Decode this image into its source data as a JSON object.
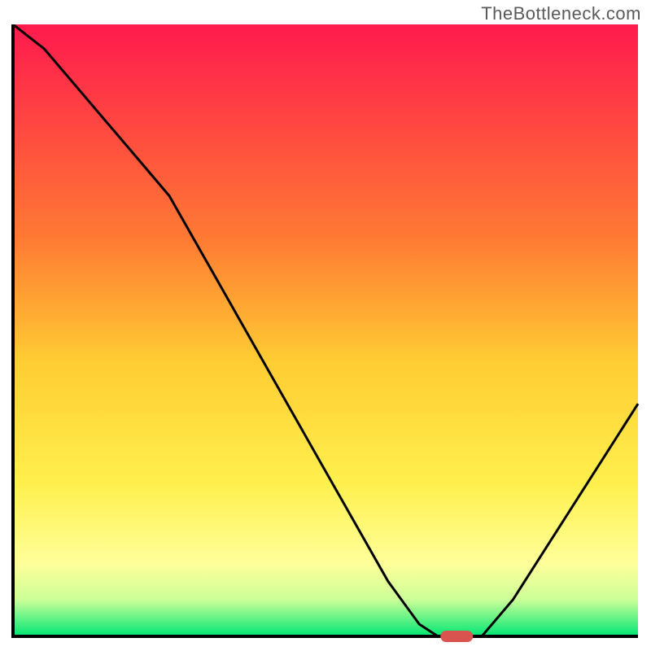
{
  "watermark": "TheBottleneck.com",
  "chart_data": {
    "type": "line",
    "title": "",
    "xlabel": "",
    "ylabel": "",
    "xlim": [
      0,
      100
    ],
    "ylim": [
      0,
      100
    ],
    "x": [
      0,
      5,
      10,
      15,
      20,
      25,
      30,
      35,
      40,
      45,
      50,
      55,
      60,
      65,
      68,
      72,
      75,
      80,
      85,
      90,
      95,
      100
    ],
    "values": [
      102,
      96,
      90,
      84,
      78,
      72,
      63,
      54,
      45,
      36,
      27,
      18,
      9,
      2,
      0,
      0,
      0,
      6,
      14,
      22,
      30,
      38
    ],
    "marker": {
      "x": 71,
      "y": 0
    },
    "gradient_stops": [
      {
        "offset": 0,
        "color": "#ff1a4d"
      },
      {
        "offset": 35,
        "color": "#ff7a33"
      },
      {
        "offset": 55,
        "color": "#ffcc33"
      },
      {
        "offset": 75,
        "color": "#fff04d"
      },
      {
        "offset": 88,
        "color": "#ffff99"
      },
      {
        "offset": 94,
        "color": "#ccff99"
      },
      {
        "offset": 100,
        "color": "#00e673"
      }
    ],
    "marker_color": "#d9534f",
    "axis_color": "#000000"
  }
}
